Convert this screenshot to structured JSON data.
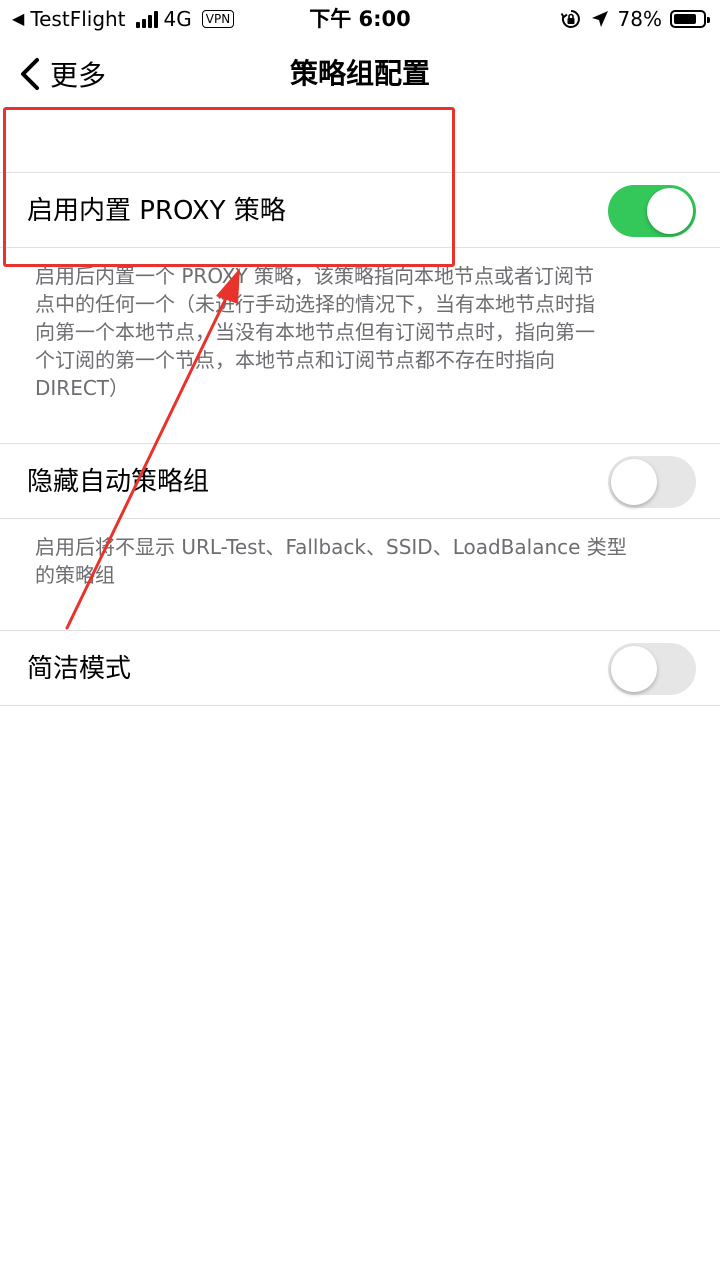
{
  "status_bar": {
    "back_app": "TestFlight",
    "network": "4G",
    "vpn": "VPN",
    "time": "下午 6:00",
    "battery": "78%",
    "battery_level": 0.78
  },
  "nav": {
    "back_label": "更多",
    "title": "策略组配置"
  },
  "settings": [
    {
      "label": "启用内置 PROXY 策略",
      "enabled": true,
      "description_lines": [
        "启用后内置一个 PROXY 策略，该策略指向本地节点或者订阅节",
        "点中的任何一个（未进行手动选择的情况下，当有本地节点时指",
        "向第一个本地节点，当没有本地节点但有订阅节点时，指向第一",
        "个订阅的第一个节点，本地节点和订阅节点都不存在时指向",
        "DIRECT）"
      ]
    },
    {
      "label": "隐藏自动策略组",
      "enabled": false,
      "description_lines": [
        "启用后将不显示 URL-Test、Fallback、SSID、LoadBalance 类型",
        "的策略组"
      ]
    },
    {
      "label": "简洁模式",
      "enabled": false
    }
  ],
  "colors": {
    "toggle_on": "#34c759",
    "toggle_off": "#e6e6e6",
    "annotation": "#e8332c",
    "description_text": "#6d6d72"
  }
}
